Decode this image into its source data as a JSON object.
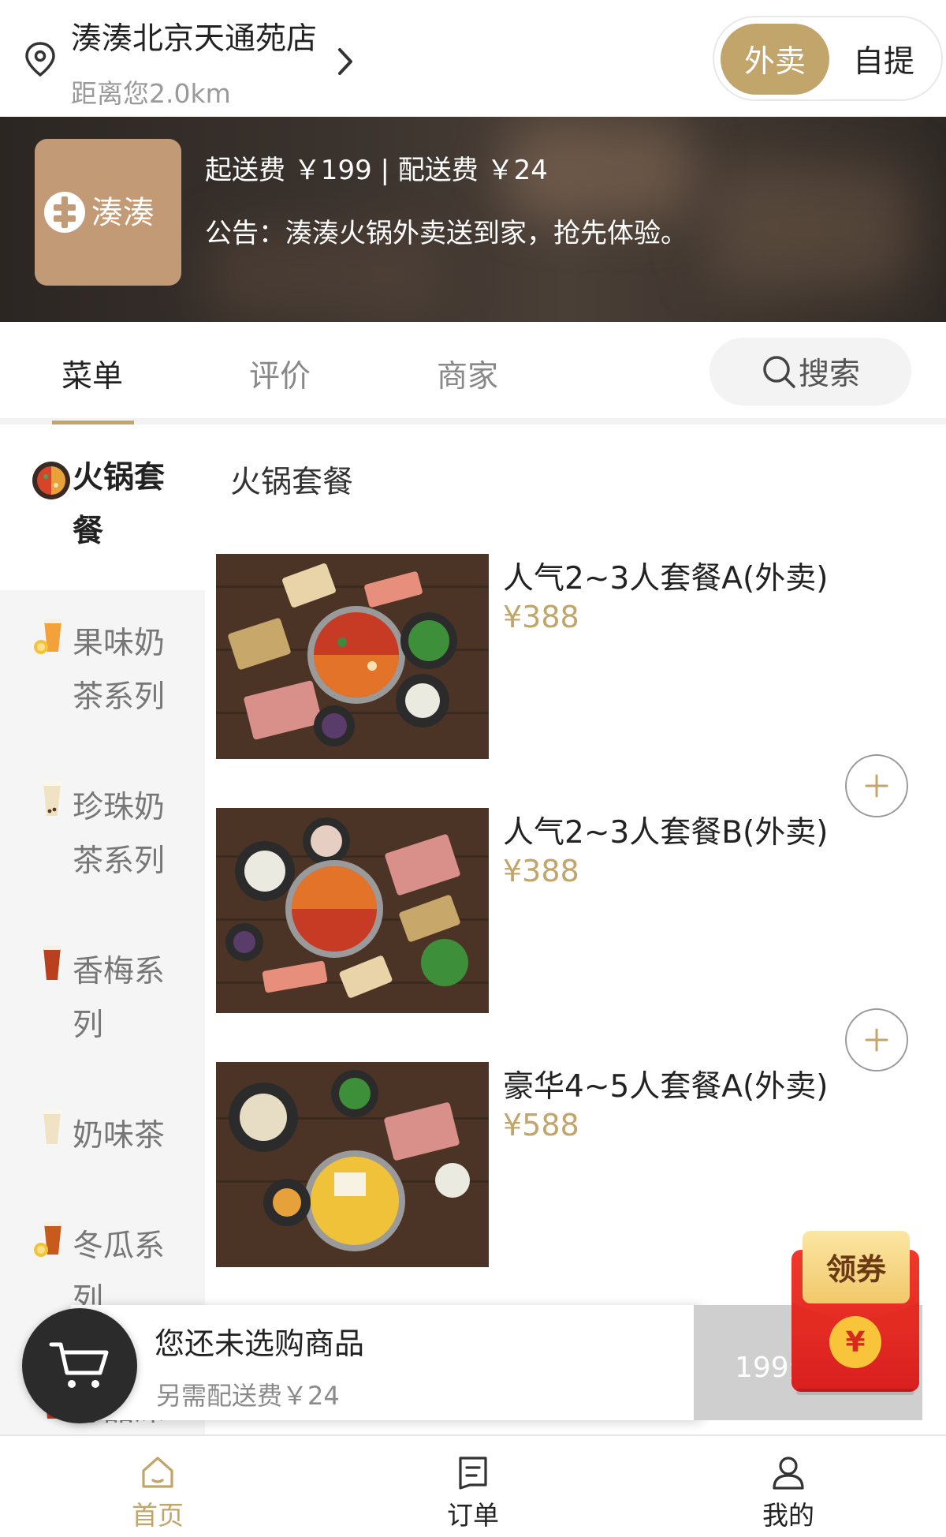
{
  "header": {
    "store_name": "湊湊北京天通苑店",
    "distance": "距离您2.0km",
    "mode_delivery": "外卖",
    "mode_pickup": "自提"
  },
  "banner": {
    "brand_logo_text": "湊湊",
    "min_fee_line": "起送费 ￥199 | 配送费 ￥24",
    "notice": "公告：湊湊火锅外卖送到家，抢先体验。"
  },
  "tabs": {
    "menu": "菜单",
    "reviews": "评价",
    "merchant": "商家",
    "search": "搜索"
  },
  "categories": [
    {
      "label": "火锅套餐",
      "icon": "hotpot-icon",
      "active": true
    },
    {
      "label": "果味奶茶系列",
      "icon": "fruit-drink-icon",
      "active": false
    },
    {
      "label": "珍珠奶茶系列",
      "icon": "milk-tea-icon",
      "active": false
    },
    {
      "label": "香梅系列",
      "icon": "plum-drink-icon",
      "active": false
    },
    {
      "label": "奶味茶",
      "icon": "milk-tea-icon",
      "active": false
    },
    {
      "label": "冬瓜系列",
      "icon": "fruit-drink-icon",
      "active": false
    },
    {
      "label": "醇品深",
      "icon": "tea-drink-icon",
      "active": false
    }
  ],
  "section_title": "火锅套餐",
  "products": [
    {
      "name": "人气2~3人套餐A(外卖)",
      "price": "¥388"
    },
    {
      "name": "人气2~3人套餐B(外卖)",
      "price": "¥388"
    },
    {
      "name": "豪华4~5人套餐A(外卖)",
      "price": "¥588"
    }
  ],
  "cart": {
    "empty_text": "您还未选购商品",
    "delivery_text": "另需配送费￥24",
    "checkout_label": "199元起送"
  },
  "coupon": {
    "label": "领券",
    "coin": "¥"
  },
  "bottom_nav": {
    "home": "首页",
    "orders": "订单",
    "mine": "我的"
  },
  "colors": {
    "accent_gold": "#c1a56b",
    "logo_tile": "#c39a76",
    "coupon_red": "#e02a22"
  }
}
